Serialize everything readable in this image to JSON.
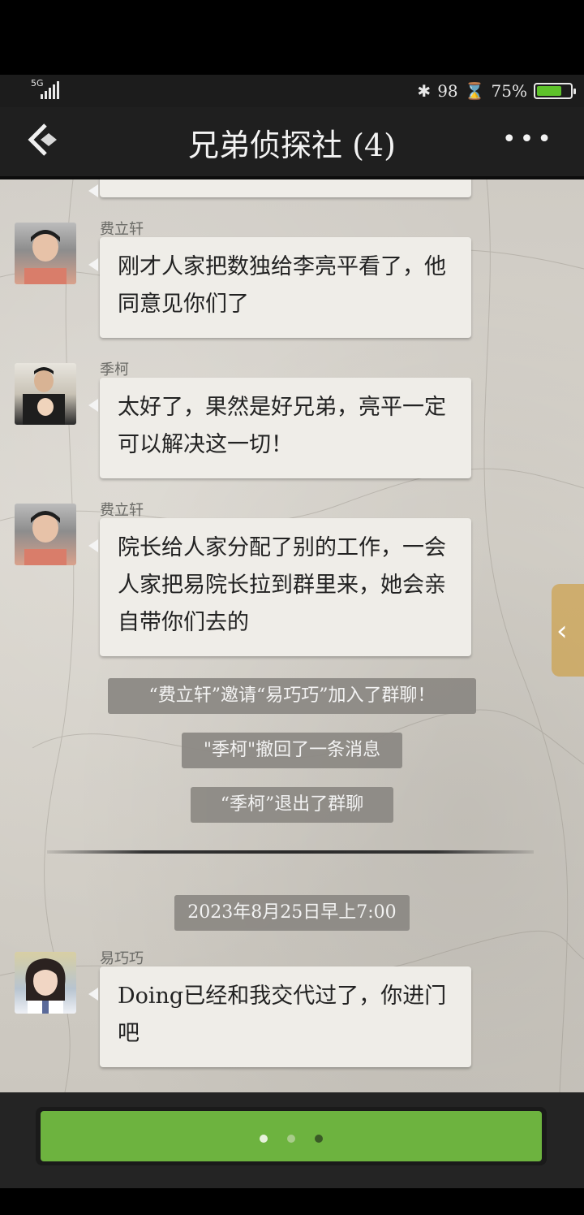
{
  "status_bar": {
    "network": "5G",
    "bluetooth_icon": "bluetooth-icon",
    "signal_value": "98",
    "hourglass_icon": "hourglass-icon",
    "battery_percent": "75%",
    "battery_level": 0.75,
    "battery_color": "#5ec22b"
  },
  "header": {
    "title": "兄弟侦探社 (4)",
    "back_icon": "back-chevron-icon",
    "more_icon": "more-dots-icon",
    "more_glyph": "•••"
  },
  "messages": [
    {
      "sender": "费立轩",
      "text": "刚才人家把数独给李亮平看了，他同意见你们了"
    },
    {
      "sender": "季柯",
      "text": "太好了，果然是好兄弟，亮平一定可以解决这一切！"
    },
    {
      "sender": "费立轩",
      "text": "院长给人家分配了别的工作，一会人家把易院长拉到群里来，她会亲自带你们去的"
    },
    {
      "sender": "易巧巧",
      "text": "Doing已经和我交代过了，你进门吧"
    }
  ],
  "system_messages": [
    "“费立轩”邀请“易巧巧”加入了群聊！",
    "\"季柯\"撤回了一条消息",
    "“季柯”退出了群聊"
  ],
  "timestamp": "2023年8月25日早上7:00",
  "side_handle_glyph": "‹",
  "bottom": {
    "button_color": "#6db33f",
    "page_dots": 3,
    "active_dot": 2
  }
}
